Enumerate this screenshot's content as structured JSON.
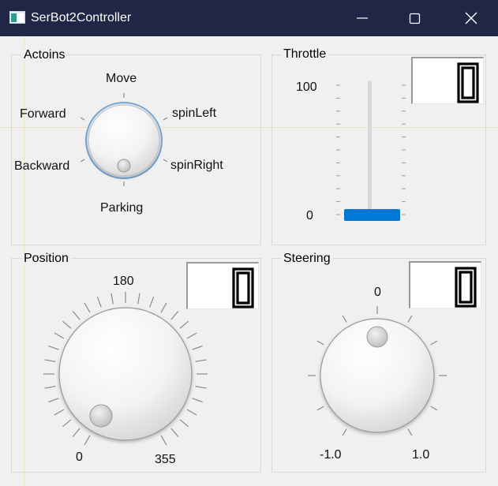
{
  "window": {
    "title": "SerBot2Controller",
    "controls": [
      "minimize-icon",
      "maximize-icon",
      "close-icon"
    ]
  },
  "actions": {
    "title": "Actoins",
    "positions": [
      "Move",
      "spinLeft",
      "spinRight",
      "Parking",
      "Backward",
      "Forward"
    ],
    "selected": "Parking"
  },
  "throttle": {
    "title": "Throttle",
    "max_label": "100",
    "min_label": "0",
    "value": 0,
    "display": "0",
    "accent": "#0078d4"
  },
  "position": {
    "title": "Position",
    "top_label": "180",
    "left_label": "0",
    "right_label": "355",
    "value": 0,
    "display": "0"
  },
  "steering": {
    "title": "Steering",
    "top_label": "0",
    "left_label": "-1.0",
    "right_label": "1.0",
    "value": 0,
    "display": "0"
  }
}
